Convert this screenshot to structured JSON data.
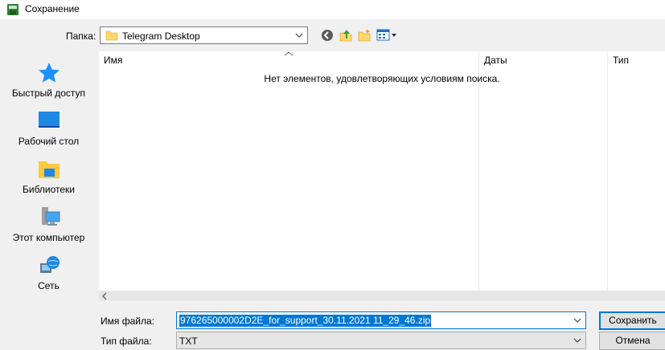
{
  "window": {
    "title": "Сохранение"
  },
  "toolbar": {
    "folder_label": "Папка:",
    "folder_value": "Telegram Desktop"
  },
  "places": [
    {
      "label": "Быстрый доступ",
      "icon": "star-icon"
    },
    {
      "label": "Рабочий стол",
      "icon": "desktop-icon"
    },
    {
      "label": "Библиотеки",
      "icon": "libraries-icon"
    },
    {
      "label": "Этот компьютер",
      "icon": "computer-icon"
    },
    {
      "label": "Сеть",
      "icon": "network-icon"
    }
  ],
  "filelist": {
    "columns": [
      "Имя",
      "Даты",
      "Тип"
    ],
    "empty_message": "Нет элементов, удовлетворяющих условиям поиска."
  },
  "form": {
    "filename_label": "Имя файла:",
    "filename_value": "976265000002D2E_for_support_30.11.2021 11_29_46.zip",
    "filetype_label": "Тип файла:",
    "filetype_value": "TXT",
    "save_label": "Сохранить",
    "cancel_label": "Отмена"
  },
  "colors": {
    "accent": "#0078d7",
    "folder": "#ffd86b",
    "star": "#1e90ff"
  }
}
